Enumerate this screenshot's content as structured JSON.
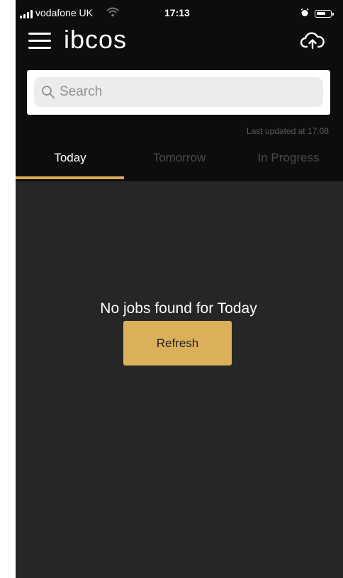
{
  "status_bar": {
    "carrier": "vodafone UK",
    "time": "17:13"
  },
  "header": {
    "logo_text": "ibcos",
    "menu_icon": "hamburger-menu-icon",
    "upload_icon": "cloud-upload-icon"
  },
  "search": {
    "placeholder": "Search",
    "value": "",
    "icon": "search-icon"
  },
  "last_updated": "Last updated at 17:08",
  "tabs": [
    {
      "label": "Today",
      "active": true
    },
    {
      "label": "Tomorrow",
      "active": false
    },
    {
      "label": "In Progress",
      "active": false
    }
  ],
  "main": {
    "empty_message": "No jobs found for Today",
    "refresh_label": "Refresh"
  },
  "colors": {
    "accent": "#d8ac54",
    "header_bg": "#0d0d0d",
    "body_bg": "#262626"
  }
}
